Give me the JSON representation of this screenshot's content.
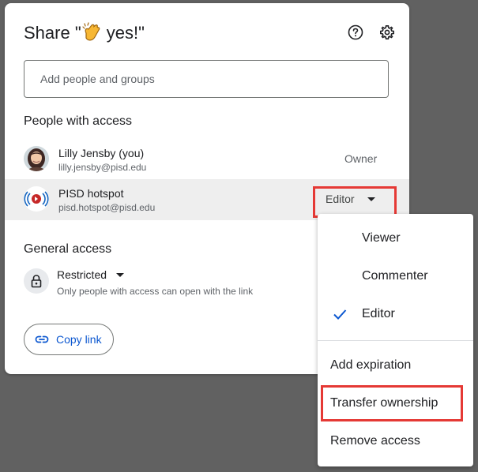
{
  "dialog": {
    "title_prefix": "Share \"",
    "title_suffix": " yes!\"",
    "title_emoji": "clapping-hands-icon",
    "help_icon": "help-circle-icon",
    "settings_icon": "gear-icon"
  },
  "add_people": {
    "placeholder": "Add people and groups"
  },
  "people_section": {
    "title": "People with access",
    "people": [
      {
        "name": "Lilly Jensby (you)",
        "email": "lilly.jensby@pisd.edu",
        "role": "Owner"
      },
      {
        "name": "PISD hotspot",
        "email": "pisd.hotspot@pisd.edu",
        "role": "Editor"
      }
    ]
  },
  "general_access": {
    "title": "General access",
    "setting": "Restricted",
    "description": "Only people with access can open with the link",
    "icon": "lock-icon"
  },
  "copy_link": {
    "label": "Copy link",
    "icon": "link-icon"
  },
  "role_menu": {
    "roles": [
      "Viewer",
      "Commenter",
      "Editor"
    ],
    "selected": "Editor",
    "actions": [
      "Add expiration",
      "Transfer ownership",
      "Remove access"
    ]
  },
  "colors": {
    "backdrop": "#616161",
    "accent": "#0b57d0",
    "highlight": "#e53935",
    "selected_row": "#eeeeee"
  }
}
